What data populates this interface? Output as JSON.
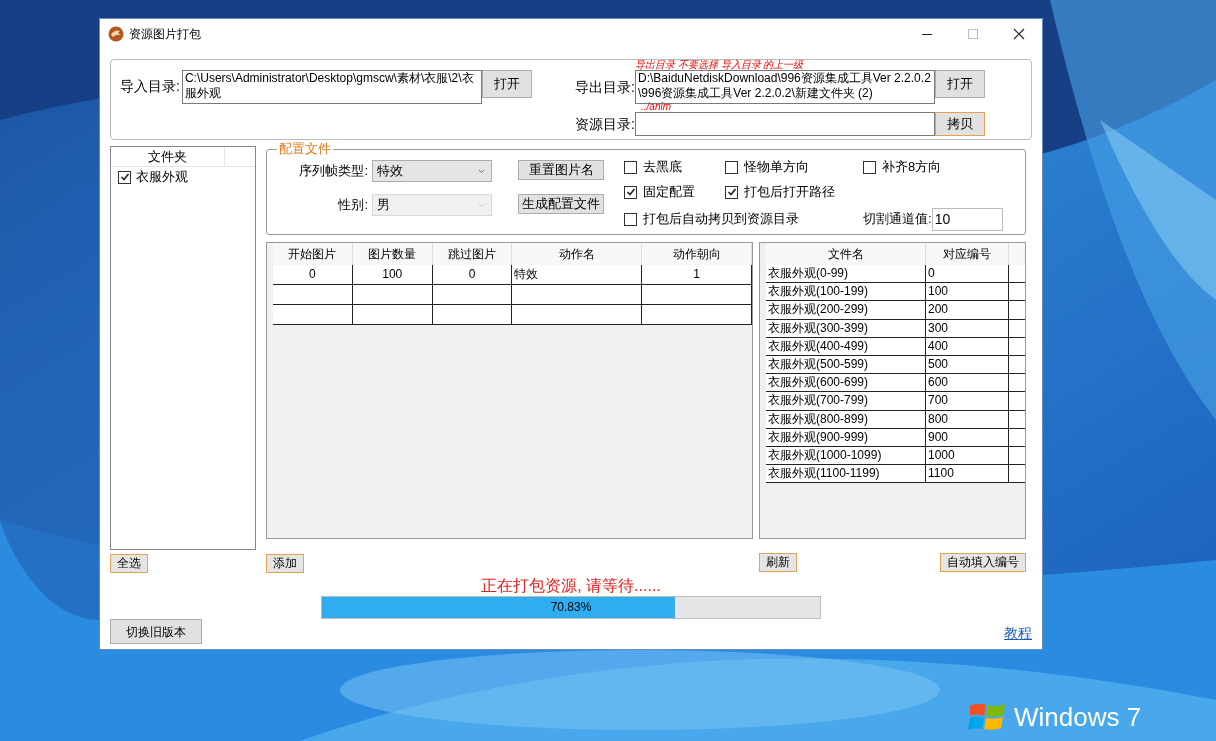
{
  "window": {
    "title": "资源图片打包"
  },
  "import": {
    "label": "导入目录:",
    "value": "C:\\Users\\Administrator\\Desktop\\gmscw\\素材\\衣服\\2\\衣服外观",
    "button": "打开"
  },
  "export": {
    "note": "导出目录 不要选择 导入目录 的上一级",
    "label": "导出目录:",
    "value": "D:\\BaiduNetdiskDownload\\996资源集成工具Ver 2.2.0.2\\996资源集成工具Ver 2.2.0.2\\新建文件夹 (2)",
    "button": "打开",
    "sub_note": "../anim"
  },
  "resource": {
    "label": "资源目录:",
    "button": "拷贝"
  },
  "folders": {
    "header": "文件夹",
    "items": [
      {
        "label": "衣服外观",
        "checked": true
      }
    ],
    "button": "全选"
  },
  "config": {
    "title": "配置文件",
    "fields": [
      {
        "label": "序列帧类型:",
        "value": "特效",
        "disabled": false
      },
      {
        "label": "性别:",
        "value": "男",
        "disabled": true
      }
    ],
    "buttons": [
      "重置图片名",
      "生成配置文件"
    ],
    "options": [
      {
        "label": "去黑底",
        "checked": false
      },
      {
        "label": "怪物单方向",
        "checked": false
      },
      {
        "label": "补齐8方向",
        "checked": false
      },
      {
        "label": "固定配置",
        "checked": true
      },
      {
        "label": "打包后打开路径",
        "checked": true
      },
      {
        "label": "打包后自动拷贝到资源目录",
        "checked": false
      }
    ],
    "threshold": {
      "label": "切割通道值:",
      "value": "10"
    }
  },
  "actions": {
    "columns": [
      "开始图片",
      "图片数量",
      "跳过图片",
      "动作名",
      "动作朝向"
    ],
    "rows": [
      [
        "0",
        "100",
        "0",
        "特效",
        "1"
      ]
    ],
    "button": "添加"
  },
  "files": {
    "columns": [
      "文件名",
      "对应编号"
    ],
    "rows": [
      [
        "衣服外观(0-99)",
        "0"
      ],
      [
        "衣服外观(100-199)",
        "100"
      ],
      [
        "衣服外观(200-299)",
        "200"
      ],
      [
        "衣服外观(300-399)",
        "300"
      ],
      [
        "衣服外观(400-499)",
        "400"
      ],
      [
        "衣服外观(500-599)",
        "500"
      ],
      [
        "衣服外观(600-699)",
        "600"
      ],
      [
        "衣服外观(700-799)",
        "700"
      ],
      [
        "衣服外观(800-899)",
        "800"
      ],
      [
        "衣服外观(900-999)",
        "900"
      ],
      [
        "衣服外观(1000-1099)",
        "1000"
      ],
      [
        "衣服外观(1100-1199)",
        "1100"
      ]
    ],
    "buttons": [
      "刷新",
      "自动填入编号"
    ]
  },
  "status": {
    "message": "正在打包资源, 请等待......",
    "progress": {
      "level": 0.7083,
      "reading": "70.83%"
    }
  },
  "footer": {
    "button": "切换旧版本",
    "link": "教程"
  },
  "desktop": {
    "logo_text": "Windows 7"
  }
}
